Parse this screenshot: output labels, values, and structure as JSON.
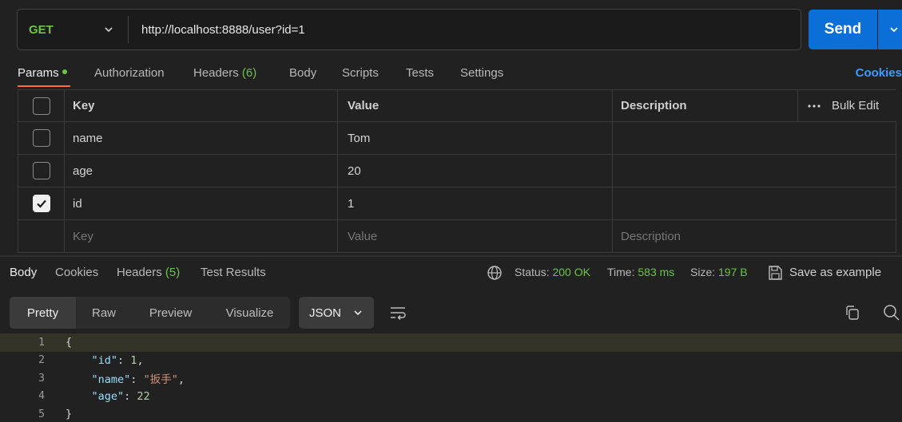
{
  "request": {
    "method": "GET",
    "url": "http://localhost:8888/user?id=1",
    "send_label": "Send"
  },
  "req_tabs": {
    "params": "Params",
    "authorization": "Authorization",
    "headers": "Headers",
    "headers_count": "(6)",
    "body": "Body",
    "scripts": "Scripts",
    "tests": "Tests",
    "settings": "Settings",
    "cookies": "Cookies"
  },
  "params_table": {
    "headers": {
      "key": "Key",
      "value": "Value",
      "description": "Description",
      "bulk_edit": "Bulk Edit"
    },
    "rows": [
      {
        "key": "name",
        "value": "Tom",
        "checked": false
      },
      {
        "key": "age",
        "value": "20",
        "checked": false
      },
      {
        "key": "id",
        "value": "1",
        "checked": true
      }
    ],
    "placeholders": {
      "key": "Key",
      "value": "Value",
      "description": "Description"
    }
  },
  "response": {
    "tabs": {
      "body": "Body",
      "cookies": "Cookies",
      "headers": "Headers",
      "headers_count": "(5)",
      "test_results": "Test Results"
    },
    "status_label": "Status:",
    "status_value": "200 OK",
    "time_label": "Time:",
    "time_value": "583 ms",
    "size_label": "Size:",
    "size_value": "197 B",
    "save_example": "Save as example",
    "view_modes": [
      "Pretty",
      "Raw",
      "Preview",
      "Visualize"
    ],
    "format": "JSON",
    "code": {
      "line_numbers": [
        "1",
        "2",
        "3",
        "4",
        "5"
      ],
      "open_brace": "{",
      "close_brace": "}",
      "fields": [
        {
          "key": "\"id\"",
          "value": "1",
          "type": "number",
          "comma": ","
        },
        {
          "key": "\"name\"",
          "value": "\"扳手\"",
          "type": "string",
          "comma": ","
        },
        {
          "key": "\"age\"",
          "value": "22",
          "type": "number",
          "comma": ""
        }
      ]
    }
  },
  "colors": {
    "accent_orange": "#ff6c37",
    "send_blue": "#0a6fd6",
    "status_green": "#6cc24a",
    "link_blue": "#3d9bff"
  }
}
